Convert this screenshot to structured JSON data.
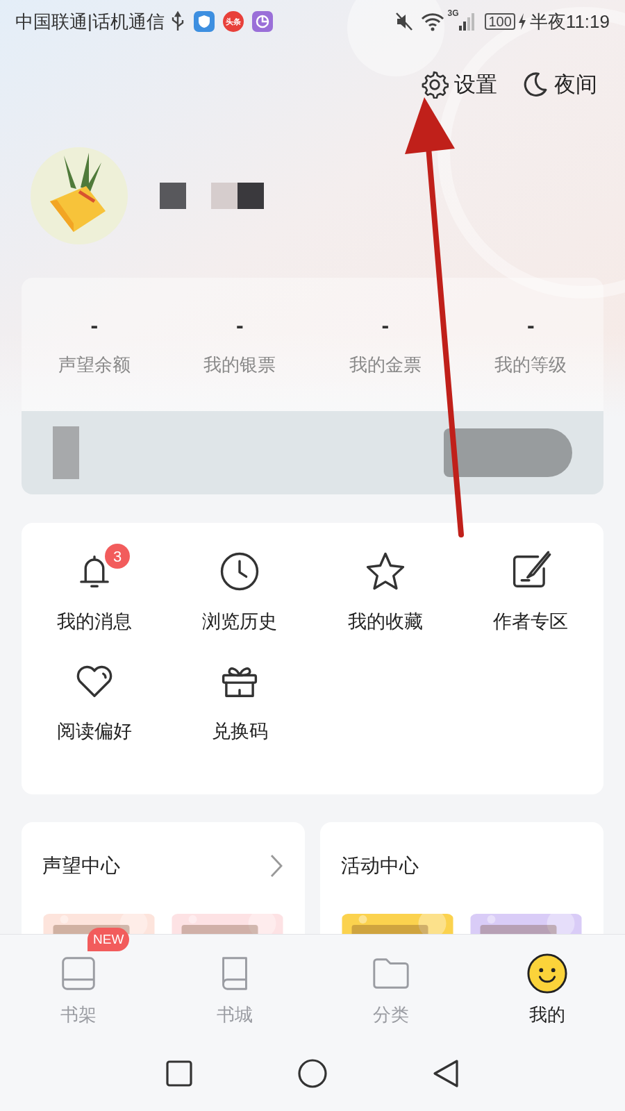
{
  "status_bar": {
    "carrier": "中国联通|话机通信",
    "app_badge": "头条",
    "network": "3G",
    "battery": "100",
    "time": "半夜11:19"
  },
  "header_actions": [
    {
      "kind": "settings",
      "label": "设置"
    },
    {
      "kind": "night",
      "label": "夜间"
    }
  ],
  "stats": [
    {
      "value": "-",
      "label": "声望余额"
    },
    {
      "value": "-",
      "label": "我的银票"
    },
    {
      "value": "-",
      "label": "我的金票"
    },
    {
      "value": "-",
      "label": "我的等级"
    }
  ],
  "menu": [
    {
      "kind": "bell",
      "label": "我的消息",
      "badge": "3"
    },
    {
      "kind": "clock",
      "label": "浏览历史"
    },
    {
      "kind": "star",
      "label": "我的收藏"
    },
    {
      "kind": "pen",
      "label": "作者专区"
    },
    {
      "kind": "heart",
      "label": "阅读偏好"
    },
    {
      "kind": "gift",
      "label": "兑换码"
    }
  ],
  "cards": [
    {
      "title": "声望中心",
      "has_more": true,
      "tiles": [
        {
          "color": "#fde4dc"
        },
        {
          "color": "#fde2e4"
        }
      ]
    },
    {
      "title": "活动中心",
      "has_more": false,
      "tiles": [
        {
          "color": "#fbd24e"
        },
        {
          "color": "#d9ccf7"
        }
      ]
    }
  ],
  "tabs": [
    {
      "kind": "shelf",
      "label": "书架",
      "badge": "NEW",
      "selected": false
    },
    {
      "kind": "book",
      "label": "书城",
      "selected": false
    },
    {
      "kind": "folder",
      "label": "分类",
      "selected": false
    },
    {
      "kind": "me",
      "label": "我的",
      "selected": true
    }
  ]
}
